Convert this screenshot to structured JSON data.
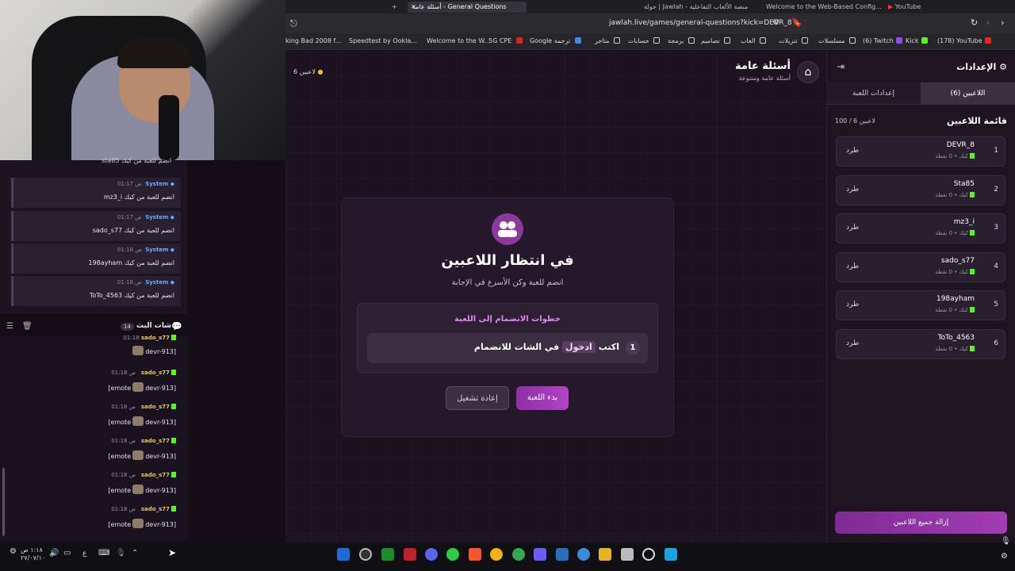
{
  "browser": {
    "tabs": [
      {
        "label": "YouTube"
      },
      {
        "label": "Welcome to the Web-Based Config..."
      },
      {
        "label": "جولة | Jawlah - منصة الألعاب التفاعلية"
      },
      {
        "label": "أسئلة عامة - General Questions",
        "active": true
      }
    ],
    "url": "jawlah.live/games/general-questions?kick=DEVR_8",
    "bookmarks": [
      "(178) YouTube",
      "Kick",
      "(6) Twitch",
      "مسلسلات",
      "تنزيلات",
      "العاب",
      "تصاميم",
      "برمجة",
      "حسابات",
      "متاجر",
      "Google ترجمة",
      "5G CPE",
      "Welcome to the W...",
      "Speedtest by Ookla...",
      "king Bad 2008 f..."
    ]
  },
  "stream_chat_top": {
    "partial_text": "sta85 انضم للعبة من كيك",
    "messages": [
      {
        "sender": "System",
        "time": "01:17 ص",
        "text": "mz3_i انضم للعبة من كيك"
      },
      {
        "sender": "System",
        "time": "01:17 ص",
        "text": "sado_s77 انضم للعبة من كيك"
      },
      {
        "sender": "System",
        "time": "01:18 ص",
        "text": "198ayham انضم للعبة من كيك"
      },
      {
        "sender": "System",
        "time": "01:18 ص",
        "text": "ToTo_4563 انضم للعبة من كيك"
      }
    ]
  },
  "stream_chat": {
    "title": "شات البث",
    "count": "14",
    "partial": {
      "user": "sado_s77",
      "time": "01:18",
      "text": "devr-913]"
    },
    "messages": [
      {
        "user": "sado_s77",
        "time": "01:18 ص",
        "text_before": "[emote",
        "text_after": "devr-913]"
      },
      {
        "user": "sado_s77",
        "time": "01:18 ص",
        "text_before": "[emote",
        "text_after": "devr-913]"
      },
      {
        "user": "sado_s77",
        "time": "01:18 ص",
        "text_before": "[emote",
        "text_after": "devr-913]"
      },
      {
        "user": "sado_s77",
        "time": "01:18 ص",
        "text_before": "[emote",
        "text_after": "devr-913]"
      },
      {
        "user": "sado_s77",
        "time": "01:18 ص",
        "text_before": "[emote",
        "text_after": "devr-913]"
      }
    ]
  },
  "header": {
    "title": "أسئلة عامة",
    "subtitle": "أسئلة عامة ومتنوعة",
    "players_count": "6 لاعبين"
  },
  "waiting": {
    "title": "في انتظار اللاعبين",
    "subtitle": "انضم للعبة وكن الأسرع في الإجابة",
    "steps_title": "خطوات الانضمام إلى اللعبة",
    "step_num": "1",
    "step_pre": "اكتب",
    "step_keyword": "ادخول",
    "step_post": "في الشات للانضمام",
    "start_button": "بدء اللعبة",
    "restart_button": "إعادة تشغيل"
  },
  "settings": {
    "title": "الإعدادات",
    "tab_players": "اللاعبين (6)",
    "tab_game": "إعدادات اللعبة",
    "list_title": "قائمة اللاعبين",
    "list_count": "100 / 6 لاعبين",
    "kick_label": "طرد",
    "players": [
      {
        "num": "1",
        "name": "DEVR_8",
        "sub": "كيك • 0 نقطة"
      },
      {
        "num": "2",
        "name": "Sta85",
        "sub": "كيك • 0 نقطة"
      },
      {
        "num": "3",
        "name": "mz3_i",
        "sub": "كيك • 0 نقطة"
      },
      {
        "num": "4",
        "name": "sado_s77",
        "sub": "كيك • 0 نقطة"
      },
      {
        "num": "5",
        "name": "198ayham",
        "sub": "كيك • 0 نقطة"
      },
      {
        "num": "6",
        "name": "ToTo_4563",
        "sub": "كيك • 0 نقطة"
      }
    ],
    "remove_all": "إزالة جميع اللاعبين"
  },
  "taskbar": {
    "time": "١:١٨ ص",
    "date": "٢٧/٠٧/١٠",
    "lang": "ع"
  },
  "colors": {
    "accent": "#a33cb6",
    "kick_green": "#53fc18",
    "bg": "#1d121f"
  }
}
